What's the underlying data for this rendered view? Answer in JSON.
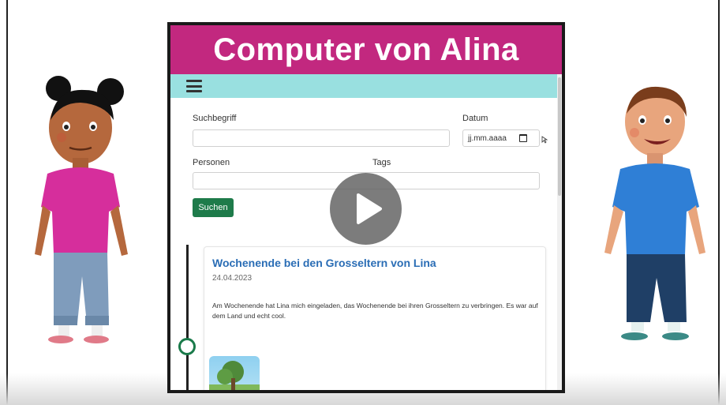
{
  "video": {
    "title": "Computer von Alina",
    "play_icon": "play-icon"
  },
  "colors": {
    "title_bar": "#c2287f",
    "nav_bar": "#99e0e0",
    "button": "#1e7b4a",
    "link": "#2a6db5"
  },
  "app": {
    "nav": {
      "menu_icon": "hamburger-icon"
    },
    "search_form": {
      "search_label": "Suchbegriff",
      "search_value": "",
      "date_label": "Datum",
      "date_placeholder": "jj.mm.aaaa",
      "persons_label": "Personen",
      "persons_value": "",
      "tags_label": "Tags",
      "tags_value": "",
      "search_button": "Suchen"
    },
    "timeline": {
      "entries": [
        {
          "title": "Wochenende bei den Grosseltern von Lina",
          "date": "24.04.2023",
          "text": "Am Wochenende hat Lina mich eingeladen, das Wochenende bei ihren Grosseltern zu verbringen. Es war auf dem Land und echt cool."
        }
      ]
    }
  }
}
